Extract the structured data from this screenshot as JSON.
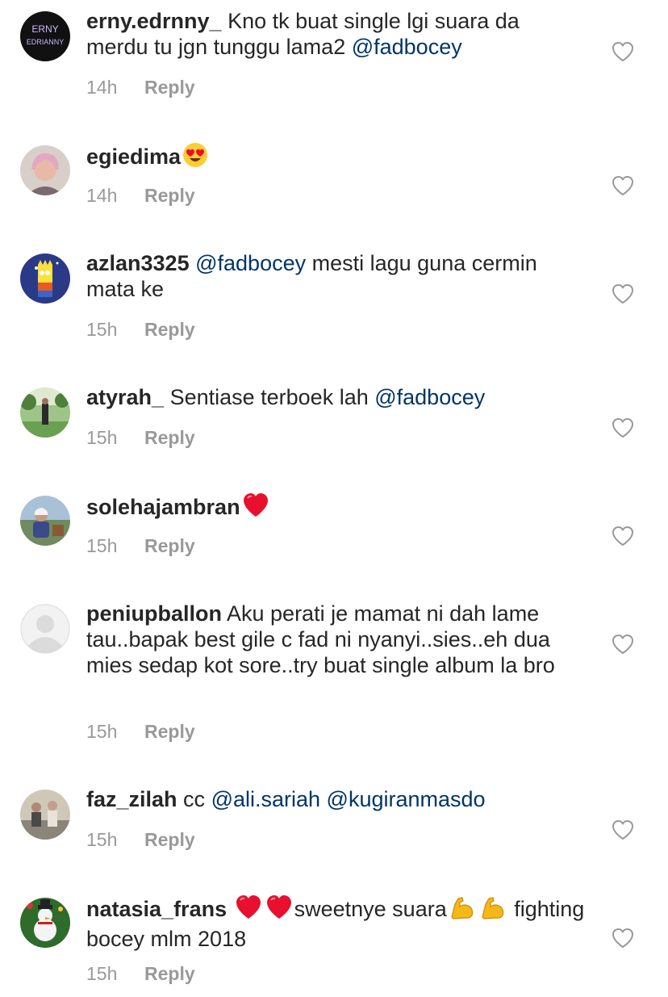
{
  "reply_label": "Reply",
  "comments": [
    {
      "username": "erny.edrnny_",
      "segments": [
        {
          "type": "text",
          "value": " Kno tk buat single lgi suara da merdu tu jgn tunggu lama2 "
        },
        {
          "type": "mention",
          "value": "@fadbocey"
        }
      ],
      "time": "14h",
      "avatar": {
        "kind": "text-logo",
        "line1": "ERNY",
        "line2": "EDRIANNY"
      }
    },
    {
      "username": "egiedima",
      "segments": [
        {
          "type": "emoji",
          "value": "heart-eyes"
        }
      ],
      "time": "14h",
      "avatar": {
        "kind": "photo-portrait"
      }
    },
    {
      "username": "azlan3325",
      "segments": [
        {
          "type": "text",
          "value": " "
        },
        {
          "type": "mention",
          "value": "@fadbocey"
        },
        {
          "type": "text",
          "value": " mesti lagu guna cermin mata ke"
        }
      ],
      "time": "15h",
      "avatar": {
        "kind": "cartoon-bart"
      }
    },
    {
      "username": "atyrah_",
      "segments": [
        {
          "type": "text",
          "value": " Sentiase terboek lah "
        },
        {
          "type": "mention",
          "value": "@fadbocey"
        }
      ],
      "time": "15h",
      "avatar": {
        "kind": "photo-park"
      }
    },
    {
      "username": "solehajambran",
      "segments": [
        {
          "type": "emoji",
          "value": "red-heart"
        }
      ],
      "time": "15h",
      "avatar": {
        "kind": "photo-outdoor"
      }
    },
    {
      "username": "peniupballon",
      "segments": [
        {
          "type": "text",
          "value": " Aku perati je mamat ni dah lame tau..bapak best gile c fad ni nyanyi..sies..eh dua mies sedap kot sore..try buat single album la bro"
        }
      ],
      "time": "15h",
      "avatar": {
        "kind": "default"
      }
    },
    {
      "username": "faz_zilah",
      "segments": [
        {
          "type": "text",
          "value": " cc "
        },
        {
          "type": "mention",
          "value": "@ali.sariah"
        },
        {
          "type": "text",
          "value": " "
        },
        {
          "type": "mention",
          "value": "@kugiranmasdo"
        }
      ],
      "time": "15h",
      "avatar": {
        "kind": "photo-group"
      }
    },
    {
      "username": "natasia_frans",
      "segments": [
        {
          "type": "text",
          "value": " "
        },
        {
          "type": "emoji",
          "value": "red-heart"
        },
        {
          "type": "emoji",
          "value": "red-heart"
        },
        {
          "type": "text",
          "value": "sweetnye suara"
        },
        {
          "type": "emoji",
          "value": "flexed-biceps"
        },
        {
          "type": "emoji",
          "value": "flexed-biceps"
        },
        {
          "type": "text",
          "value": " fighting bocey mlm 2018"
        }
      ],
      "time": "15h",
      "avatar": {
        "kind": "snowman"
      }
    }
  ],
  "icons": {
    "like": "heart-outline-icon",
    "emoji_heart_eyes": "heart-eyes-emoji",
    "emoji_red_heart": "red-heart-emoji",
    "emoji_flexed_biceps": "flexed-biceps-emoji"
  },
  "colors": {
    "text": "#262626",
    "mention": "#003569",
    "meta": "#999999",
    "background": "#ffffff"
  }
}
